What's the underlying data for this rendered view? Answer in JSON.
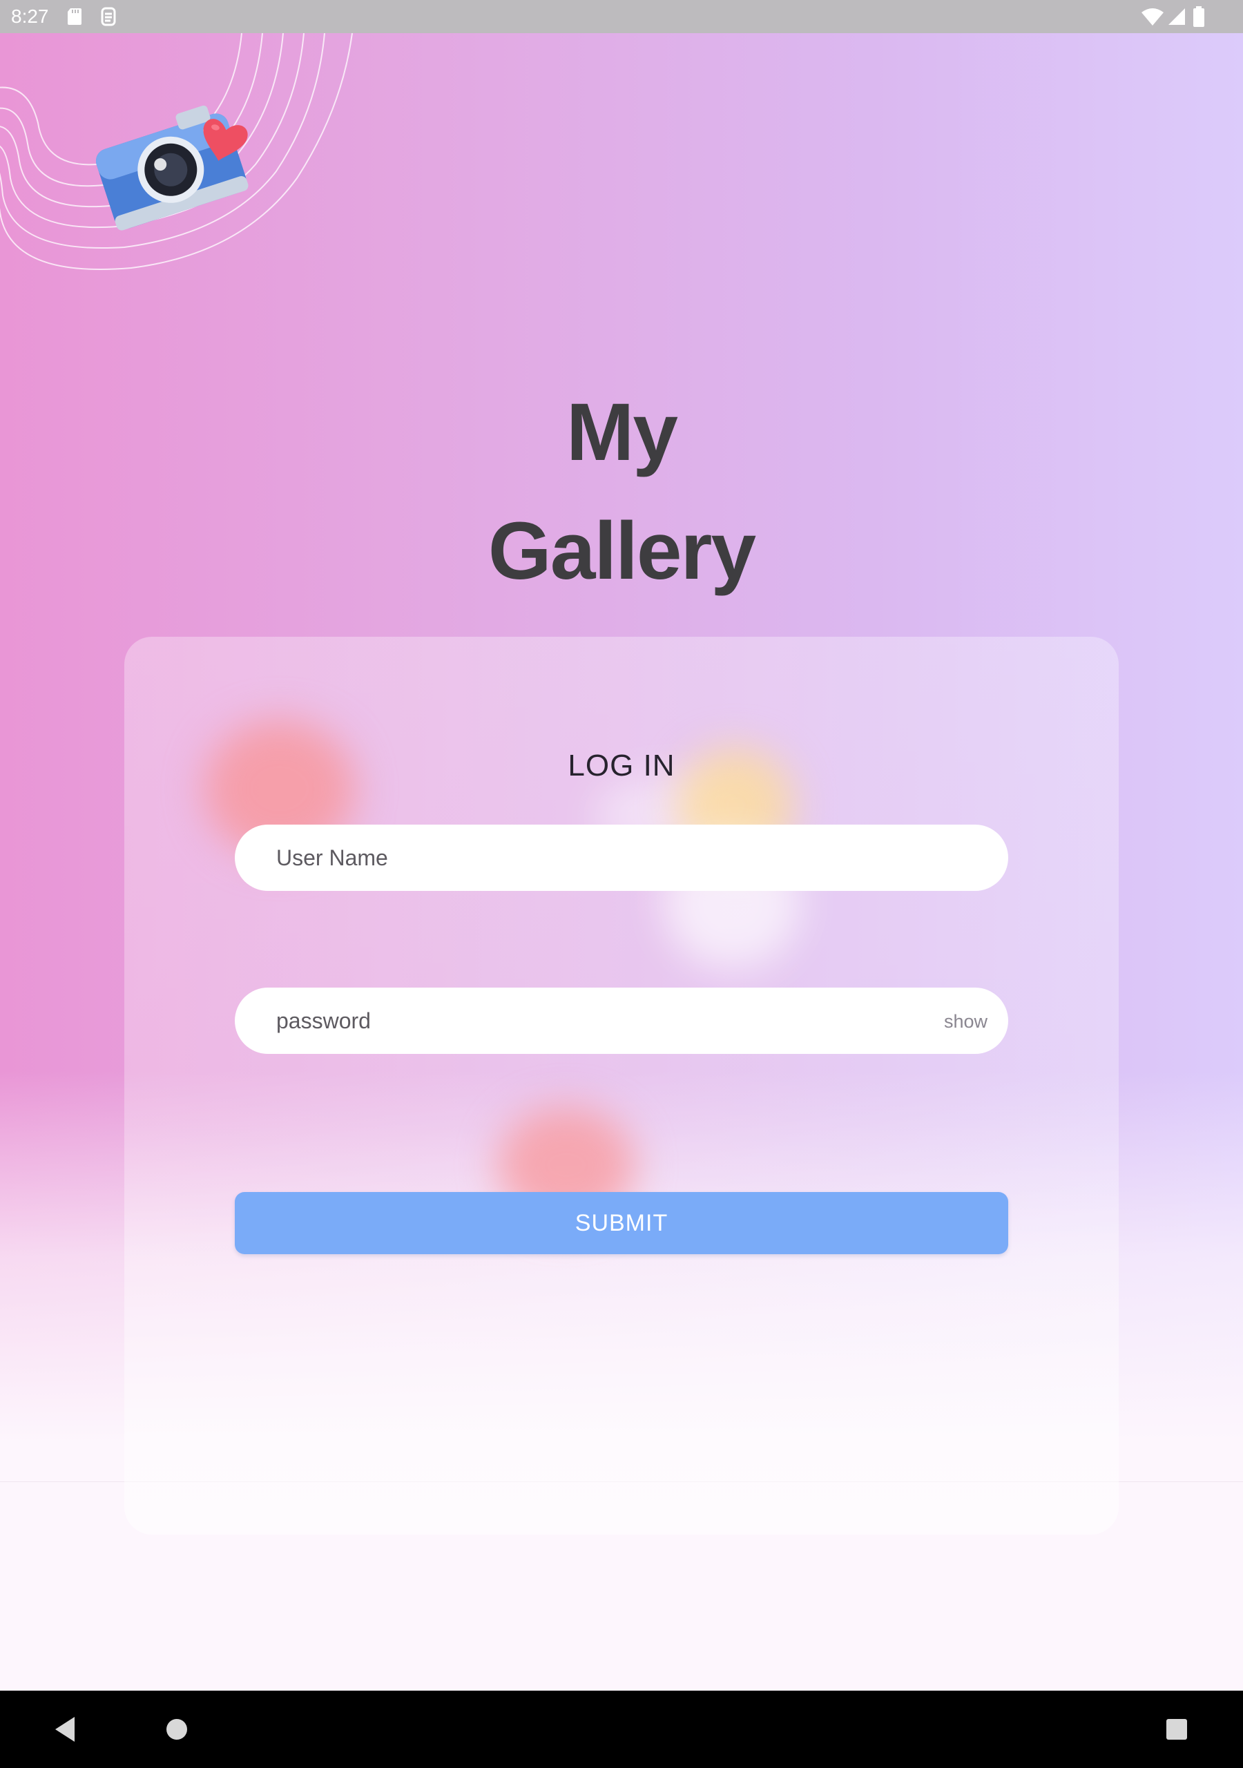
{
  "status_bar": {
    "time": "8:27",
    "icons": [
      "sd-card-icon",
      "notification-icon",
      "wifi-icon",
      "signal-icon",
      "battery-icon"
    ]
  },
  "title": {
    "line1": "My",
    "line2": "Gallery"
  },
  "login_form": {
    "heading": "LOG IN",
    "username_placeholder": "User Name",
    "password_placeholder": "password",
    "password_toggle": "show",
    "submit_label": "SUBMIT"
  },
  "decoration": {
    "icons": [
      "camera-icon",
      "heart-icon"
    ]
  },
  "nav_bar": {
    "buttons": [
      "back-icon",
      "home-icon",
      "recents-icon"
    ]
  },
  "colors": {
    "gradient_left": "#e996d6",
    "gradient_right": "#dccbfb",
    "title_text": "#3e3d40",
    "submit_button": "#7aabf8",
    "field_background": "#ffffff"
  }
}
